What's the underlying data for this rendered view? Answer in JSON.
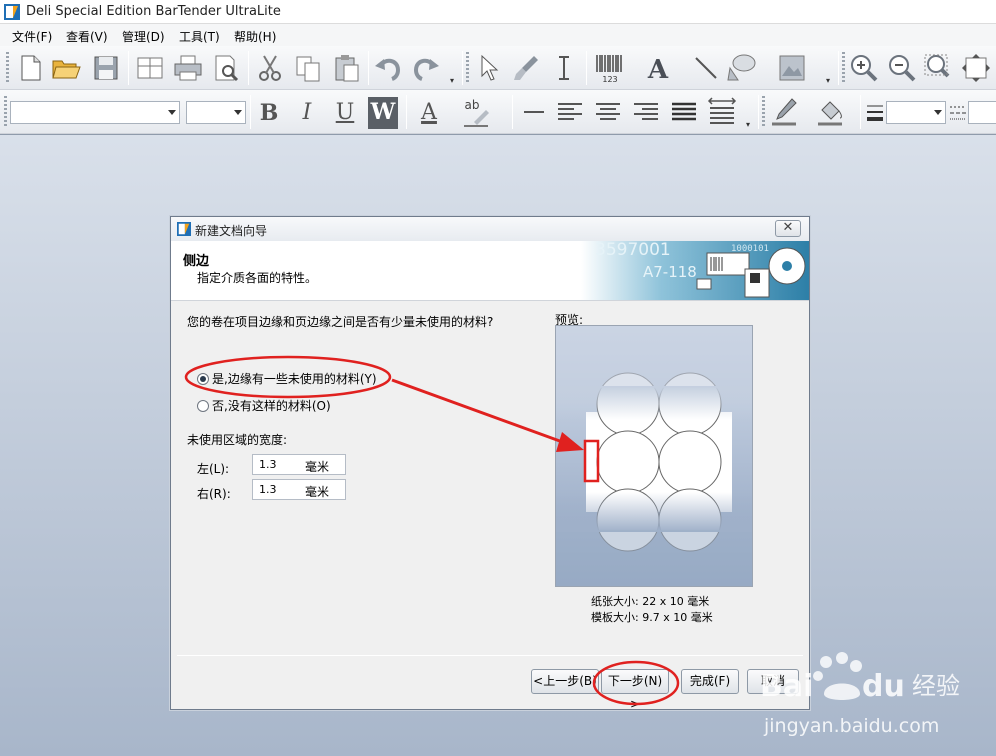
{
  "app": {
    "title": "Deli Special Edition BarTender UltraLite"
  },
  "menu": {
    "items": [
      "文件(F)",
      "查看(V)",
      "管理(D)",
      "工具(T)",
      "帮助(H)"
    ]
  },
  "toolbar": {
    "bold": "B",
    "italic": "I",
    "underline": "U",
    "wordwrap": "W",
    "font_color": "A",
    "highlight": "ab",
    "text_tool": "A",
    "barcode_digits": "123"
  },
  "dialog": {
    "title": "新建文档向导",
    "header_title": "侧边",
    "header_subtitle": "指定介质各面的特性。",
    "banner_text_1": "3597001",
    "banner_text_2": "A7-118",
    "banner_text_3": "1000101",
    "question": "您的卷在项目边缘和页边缘之间是否有少量未使用的材料?",
    "option_yes": "是,边缘有一些未使用的材料(Y)",
    "option_no": "否,没有这样的材料(O)",
    "selected_option": "yes",
    "unused_width_label": "未使用区域的宽度:",
    "left_label": "左(L):",
    "left_value": "1.3",
    "left_unit": "毫米",
    "right_label": "右(R):",
    "right_value": "1.3",
    "right_unit": "毫米",
    "preview_label": "预览:",
    "paper_size": "纸张大小:  22 x 10 毫米",
    "template_size": "模板大小:  9.7 x 10 毫米",
    "buttons": {
      "back": "<上一步(B)",
      "next": "下一步(N) >",
      "finish": "完成(F)",
      "cancel": "取消"
    }
  },
  "watermark": {
    "brand": "Bai",
    "brand2": "du",
    "brand_cn": "经验",
    "url": "jingyan.baidu.com"
  },
  "colors": {
    "annotation": "#e0211f",
    "workspace_top": "#d9e0ea",
    "workspace_bottom": "#a8b6ca",
    "header_banner": "#3f8fb4"
  }
}
